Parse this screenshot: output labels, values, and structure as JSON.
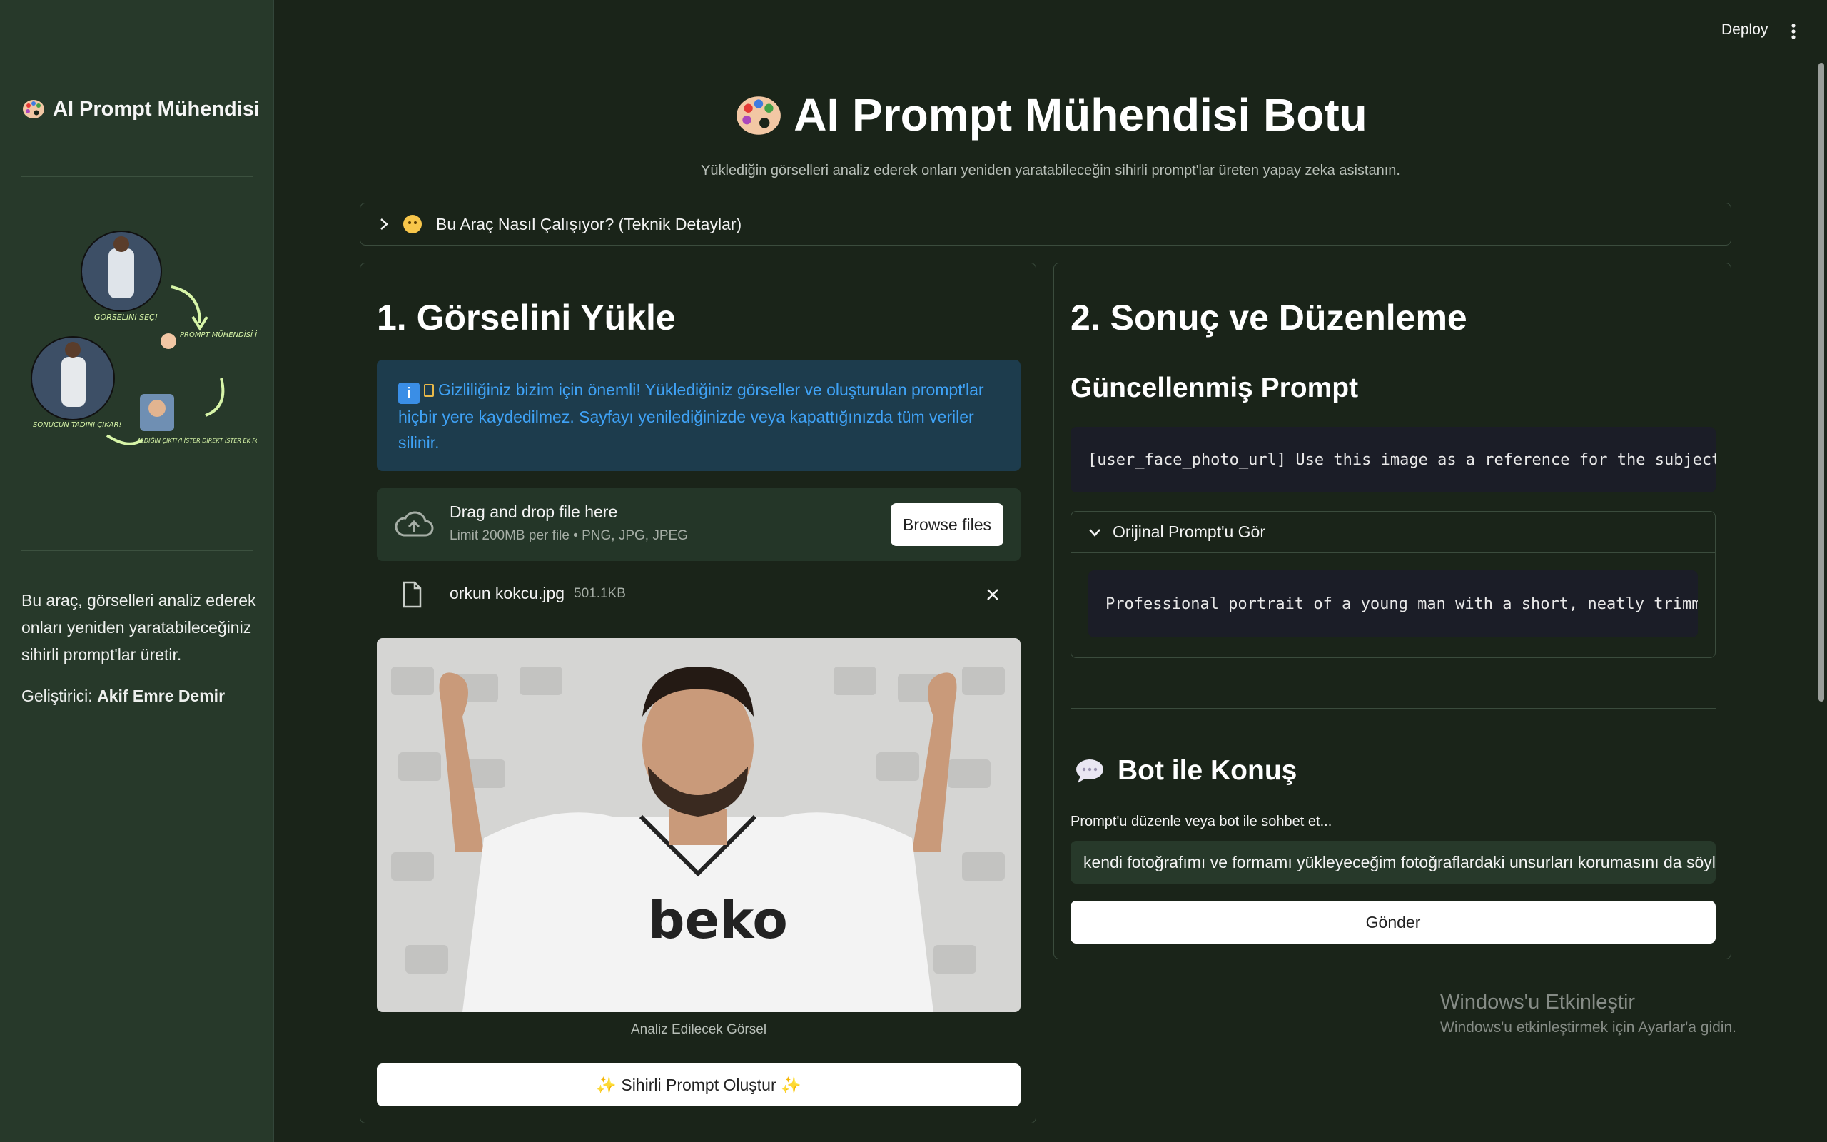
{
  "sidebar": {
    "title": "AI Prompt Mühendisi",
    "description": "Bu araç, görselleri analiz ederek onları yeniden yaratabileceğiniz sihirli prompt'lar üretir.",
    "developer_label": "Geliştirici:",
    "developer_name": "Akif Emre Demir",
    "illustration_labels": {
      "step1": "GÖRSELİNİ SEÇ!",
      "step2": "PROMPT MÜHENDİSİ İLE ÇIKTINI AL!",
      "step3": "ALDIĞIN ÇIKTIYI İSTER DİREKT İSTER EK FOTOĞRAFLA KULLAN!",
      "step4": "SONUCUN TADINI ÇIKAR!"
    }
  },
  "topbar": {
    "deploy_label": "Deploy"
  },
  "header": {
    "title": "AI Prompt Mühendisi Botu",
    "subtitle": "Yüklediğin görselleri analiz ederek onları yeniden yaratabileceğin sihirli prompt'lar üreten yapay zeka asistanın.",
    "expander_label": "Bu Araç Nasıl Çalışıyor? (Teknik Detaylar)"
  },
  "left_panel": {
    "heading": "1. Görselini Yükle",
    "info_text": "Gizliliğiniz bizim için önemli! Yüklediğiniz görseller ve oluşturulan prompt'lar hiçbir yere kaydedilmez. Sayfayı yenilediğinizde veya kapattığınızda tüm veriler silinir.",
    "uploader": {
      "title": "Drag and drop file here",
      "subtitle": "Limit 200MB per file • PNG, JPG, JPEG",
      "browse_label": "Browse files"
    },
    "file": {
      "name": "orkun kokcu.jpg",
      "size": "501.1KB"
    },
    "image_caption": "Analiz Edilecek Görsel",
    "generate_button": "✨ Sihirli Prompt Oluştur ✨"
  },
  "right_panel": {
    "heading": "2. Sonuç ve Düzenleme",
    "updated_prompt_heading": "Güncellenmiş Prompt",
    "updated_prompt_text": "[user_face_photo_url] Use this image as a reference for the subject's",
    "original_expander_label": "Orijinal Prompt'u Gör",
    "original_prompt_text": "Professional portrait of a young man with a short, neatly trimmed",
    "chat_heading": "Bot ile Konuş",
    "chat_label": "Prompt'u düzenle veya bot ile sohbet et...",
    "chat_input_value": "kendi fotoğrafımı ve formamı yükleyeceğim fotoğraflardaki unsurları korumasını da söyl",
    "send_button": "Gönder"
  },
  "watermark": {
    "line1": "Windows'u Etkinleştir",
    "line2": "Windows'u etkinleştirmek için Ayarlar'a gidin."
  },
  "colors": {
    "background": "#1a2419",
    "sidebar": "#27392a",
    "info_bg": "#1d3c4d",
    "info_text": "#3fa2f6",
    "code_bg": "#1b1d27"
  }
}
